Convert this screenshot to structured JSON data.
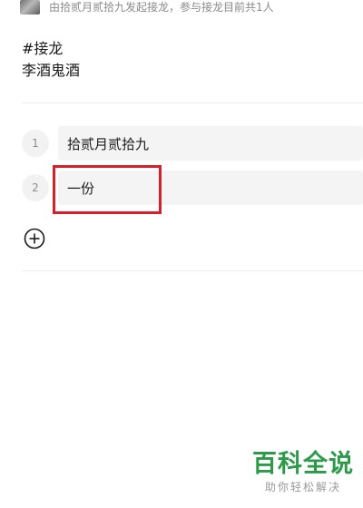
{
  "header": {
    "info_text": "由拾贰月贰拾九发起接龙，参与接龙目前共1人"
  },
  "post": {
    "topic": "#接龙",
    "description": "李酒鬼酒"
  },
  "entries": [
    {
      "index": "1",
      "value": "拾贰月贰拾九"
    },
    {
      "index": "2",
      "value": "一份"
    }
  ],
  "icons": {
    "add": "plus-circle-icon"
  },
  "watermark": {
    "main": "百科全说",
    "sub": "助你轻松解决"
  },
  "colors": {
    "highlight": "#d3202b",
    "watermark": "#2d9a4a"
  }
}
